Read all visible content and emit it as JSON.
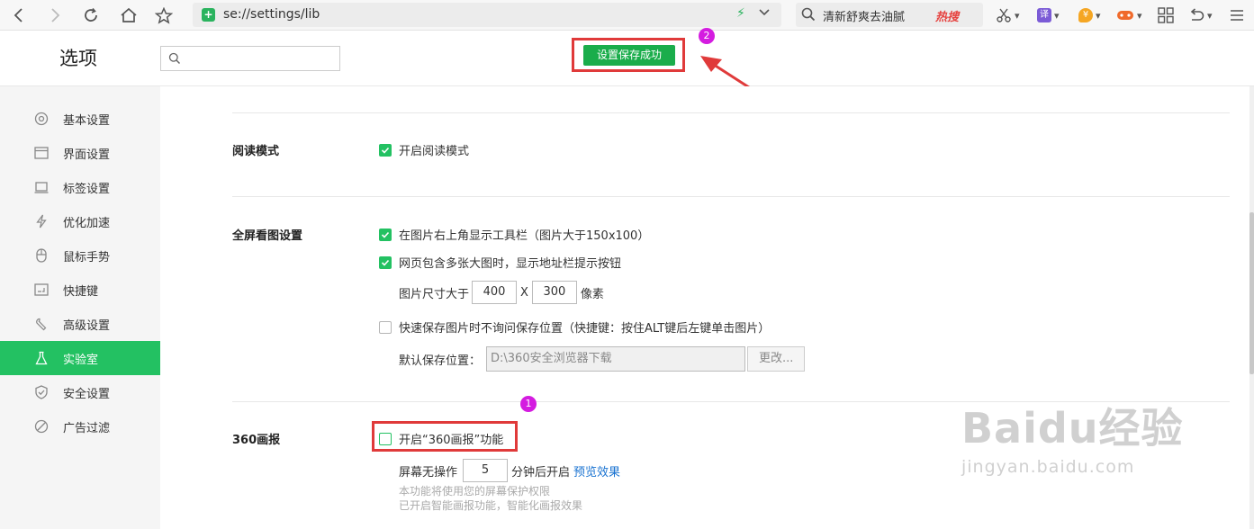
{
  "browser": {
    "url": "se://settings/lib",
    "search_query": "清新舒爽去油腻",
    "hot_label": "热搜"
  },
  "header": {
    "title": "选项",
    "save_status": "设置保存成功"
  },
  "markers": {
    "one": "1",
    "two": "2"
  },
  "sidebar": {
    "items": [
      {
        "label": "基本设置",
        "icon": "gear-icon"
      },
      {
        "label": "界面设置",
        "icon": "window-icon"
      },
      {
        "label": "标签设置",
        "icon": "tab-icon"
      },
      {
        "label": "优化加速",
        "icon": "bolt-icon"
      },
      {
        "label": "鼠标手势",
        "icon": "mouse-icon"
      },
      {
        "label": "快捷键",
        "icon": "keyboard-icon"
      },
      {
        "label": "高级设置",
        "icon": "wrench-icon"
      },
      {
        "label": "实验室",
        "icon": "flask-icon",
        "active": true
      },
      {
        "label": "安全设置",
        "icon": "shield-icon"
      },
      {
        "label": "广告过滤",
        "icon": "block-icon"
      }
    ]
  },
  "reading": {
    "label": "阅读模式",
    "opt_enable": "开启阅读模式",
    "opt_enable_checked": true
  },
  "fullscreen": {
    "label": "全屏看图设置",
    "opt_toolbar": "在图片右上角显示工具栏（图片大于150x100）",
    "opt_toolbar_checked": true,
    "opt_hint_btn": "网页包含多张大图时，显示地址栏提示按钮",
    "opt_hint_btn_checked": true,
    "size_prefix": "图片尺寸大于",
    "size_w": "400",
    "size_x": "X",
    "size_h": "300",
    "size_unit": "像素",
    "opt_quick_save": "快速保存图片时不询问保存位置（快捷键：按住ALT键后左键单击图片）",
    "opt_quick_save_checked": false,
    "default_path_label": "默认保存位置：",
    "default_path_value": "D:\\360安全浏览器下载",
    "change_btn": "更改..."
  },
  "pictorial": {
    "label": "360画报",
    "opt_enable": "开启“360画报”功能",
    "opt_enable_checked": false,
    "idle_prefix": "屏幕无操作",
    "idle_minutes": "5",
    "idle_suffix": "分钟后开启",
    "preview_link": "预览效果",
    "note1": "本功能将使用您的屏幕保护权限",
    "note2": "已开启智能画报功能，智能化画报效果"
  },
  "watermark": {
    "line1": "Baidu经验",
    "line2": "jingyan.baidu.com"
  }
}
